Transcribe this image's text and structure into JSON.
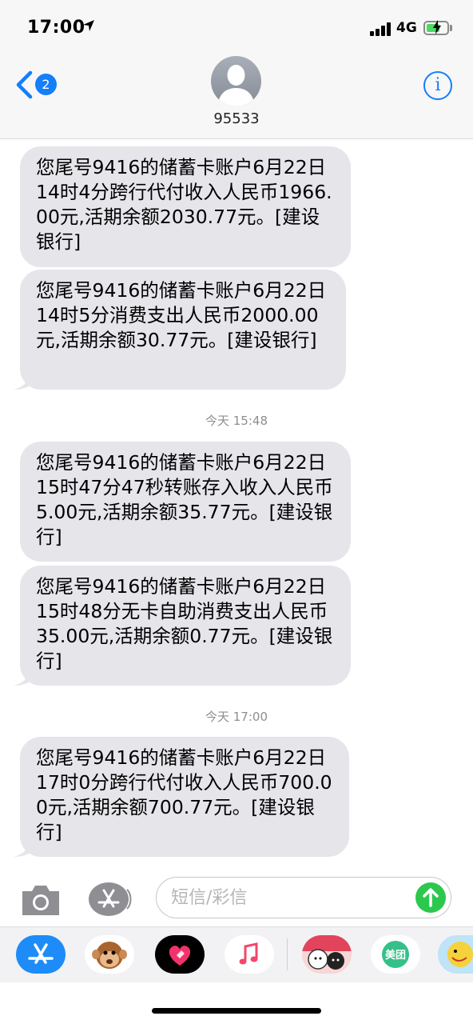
{
  "status_bar": {
    "time": "17:00",
    "network": "4G",
    "signal_bars": 4,
    "battery_level": 0.6,
    "battery_color": "#4cd964"
  },
  "header": {
    "back_badge": "2",
    "contact_name": "95533",
    "back_icon": "chevron-left-icon",
    "info_icon": "info-icon",
    "accent_color": "#147efb"
  },
  "messages": [
    {
      "text": "您尾号9416的储蓄卡账户6月22日14时4分跨行代付收入人民币1966.00元,活期余额2030.77元。[建设银行]"
    },
    {
      "text": "您尾号9416的储蓄卡账户6月22日14时5分消费支出人民币2000.00元,活期余额30.77元。[建设银行]"
    },
    {
      "timestamp": "今天 15:48"
    },
    {
      "text": "您尾号9416的储蓄卡账户6月22日15时47分47秒转账存入收入人民币5.00元,活期余额35.77元。[建设银行]"
    },
    {
      "text": "您尾号9416的储蓄卡账户6月22日15时48分无卡自助消费支出人民币35.00元,活期余额0.77元。[建设银行]"
    },
    {
      "timestamp": "今天 17:00"
    },
    {
      "text": "您尾号9416的储蓄卡账户6月22日17时0分跨行代付收入人民币700.00元,活期余额700.77元。[建设银行]"
    }
  ],
  "compose": {
    "placeholder": "短信/彩信",
    "camera_icon": "camera-icon",
    "apps_icon": "app-store-icon",
    "send_icon": "send-arrow-icon",
    "send_color": "#2cc84d"
  },
  "drawer": {
    "items": [
      {
        "icon": "app-store-icon"
      },
      {
        "icon": "animoji-monkey-icon"
      },
      {
        "icon": "digital-touch-heart-icon"
      },
      {
        "icon": "music-icon"
      },
      {
        "icon": "sticker-cats-icon"
      },
      {
        "icon": "meituan-icon",
        "label": "美团"
      },
      {
        "icon": "sticker-emoji-icon"
      }
    ]
  }
}
